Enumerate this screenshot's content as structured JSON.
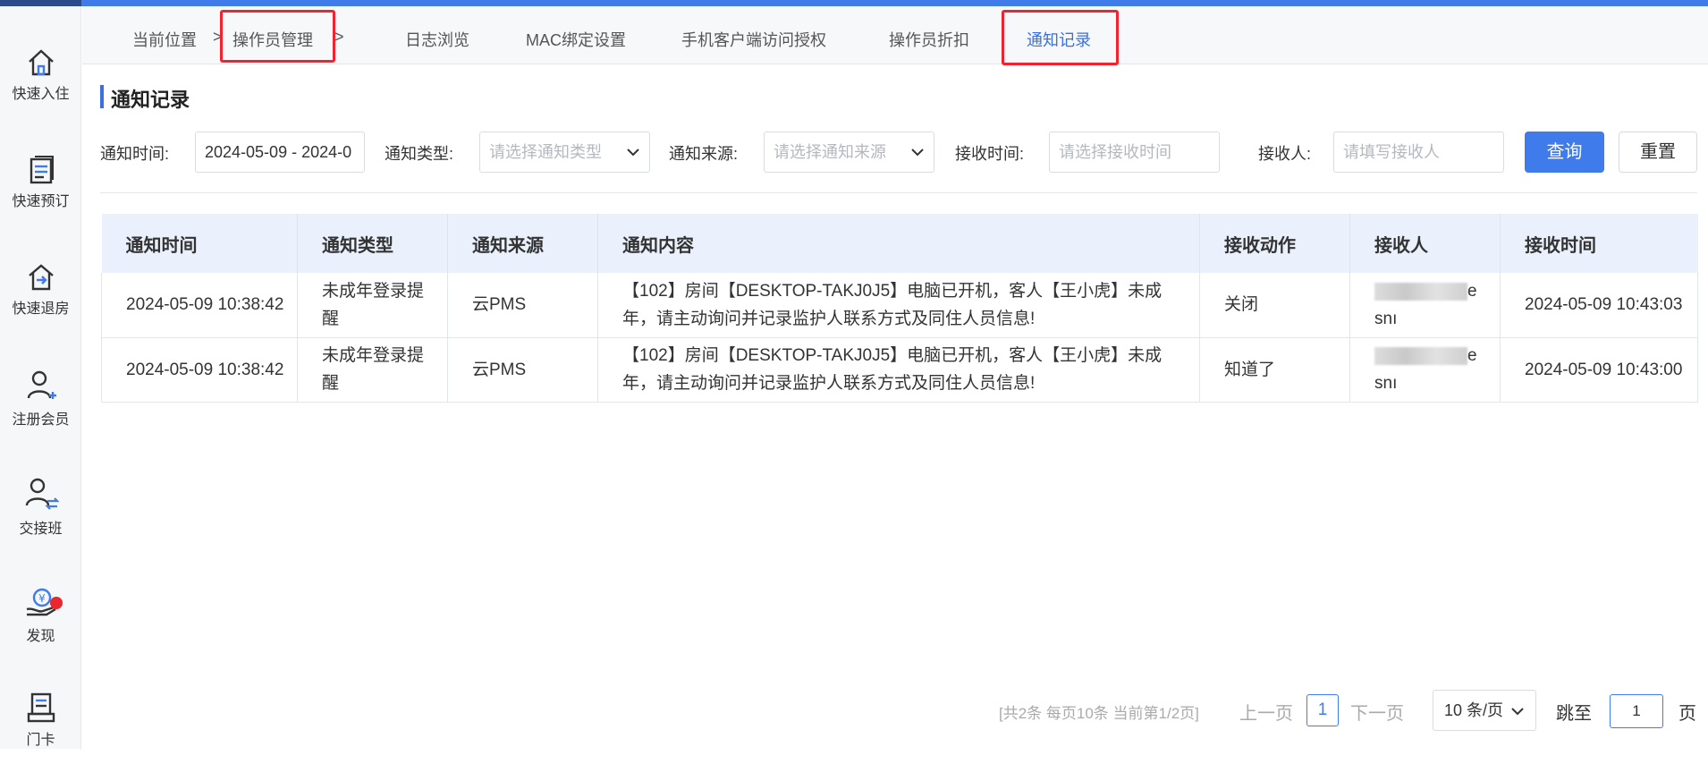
{
  "colors": {
    "accent": "#3f7bea",
    "highlight": "#f3222e",
    "badge": "#e8272e"
  },
  "sidebar": {
    "items": [
      {
        "label": "快速入住",
        "icon": "home-icon"
      },
      {
        "label": "快速预订",
        "icon": "booking-list-icon"
      },
      {
        "label": "快速退房",
        "icon": "checkout-house-icon"
      },
      {
        "label": "注册会员",
        "icon": "add-user-icon"
      },
      {
        "label": "交接班",
        "icon": "shift-handover-icon"
      },
      {
        "label": "发现",
        "icon": "discover-coin-icon"
      },
      {
        "label": "门卡",
        "icon": "door-card-icon"
      }
    ]
  },
  "breadcrumb": {
    "location": "当前位置",
    "sep": ">",
    "current": "操作员管理",
    "sep2": ">"
  },
  "tabs": [
    "日志浏览",
    "MAC绑定设置",
    "手机客户端访问授权",
    "操作员折扣",
    "通知记录"
  ],
  "page_title": "通知记录",
  "filters": {
    "notify_time_label": "通知时间:",
    "notify_time_value": "2024-05-09 - 2024-0",
    "notify_type_label": "通知类型:",
    "notify_type_placeholder": "请选择通知类型",
    "notify_source_label": "通知来源:",
    "notify_source_placeholder": "请选择通知来源",
    "receive_time_label": "接收时间:",
    "receive_time_placeholder": "请选择接收时间",
    "receiver_label": "接收人:",
    "receiver_placeholder": "请填写接收人",
    "query_button": "查询",
    "reset_button": "重置"
  },
  "table": {
    "headers": [
      "通知时间",
      "通知类型",
      "通知来源",
      "通知内容",
      "接收动作",
      "接收人",
      "接收时间"
    ],
    "rows": [
      {
        "time": "2024-05-09 10:38:42",
        "type": "未成年登录提醒",
        "source": "云PMS",
        "content": "【102】房间【DESKTOP-TAKJ0J5】电脑已开机，客人【王小虎】未成年，请主动询问并记录监护人联系方式及同住人员信息!",
        "action": "关闭",
        "receiver_a": "e",
        "receiver_b": "snı",
        "receive_time": "2024-05-09 10:43:03"
      },
      {
        "time": "2024-05-09 10:38:42",
        "type": "未成年登录提醒",
        "source": "云PMS",
        "content": "【102】房间【DESKTOP-TAKJ0J5】电脑已开机，客人【王小虎】未成年，请主动询问并记录监护人联系方式及同住人员信息!",
        "action": "知道了",
        "receiver_a": "e",
        "receiver_b": "snı",
        "receive_time": "2024-05-09 10:43:00"
      }
    ]
  },
  "pagination": {
    "info": "[共2条 每页10条 当前第1/2页]",
    "prev": "上一页",
    "current": "1",
    "next": "下一页",
    "page_size": "10 条/页",
    "jump_label": "跳至",
    "jump_value": "1",
    "page_suffix": "页"
  }
}
